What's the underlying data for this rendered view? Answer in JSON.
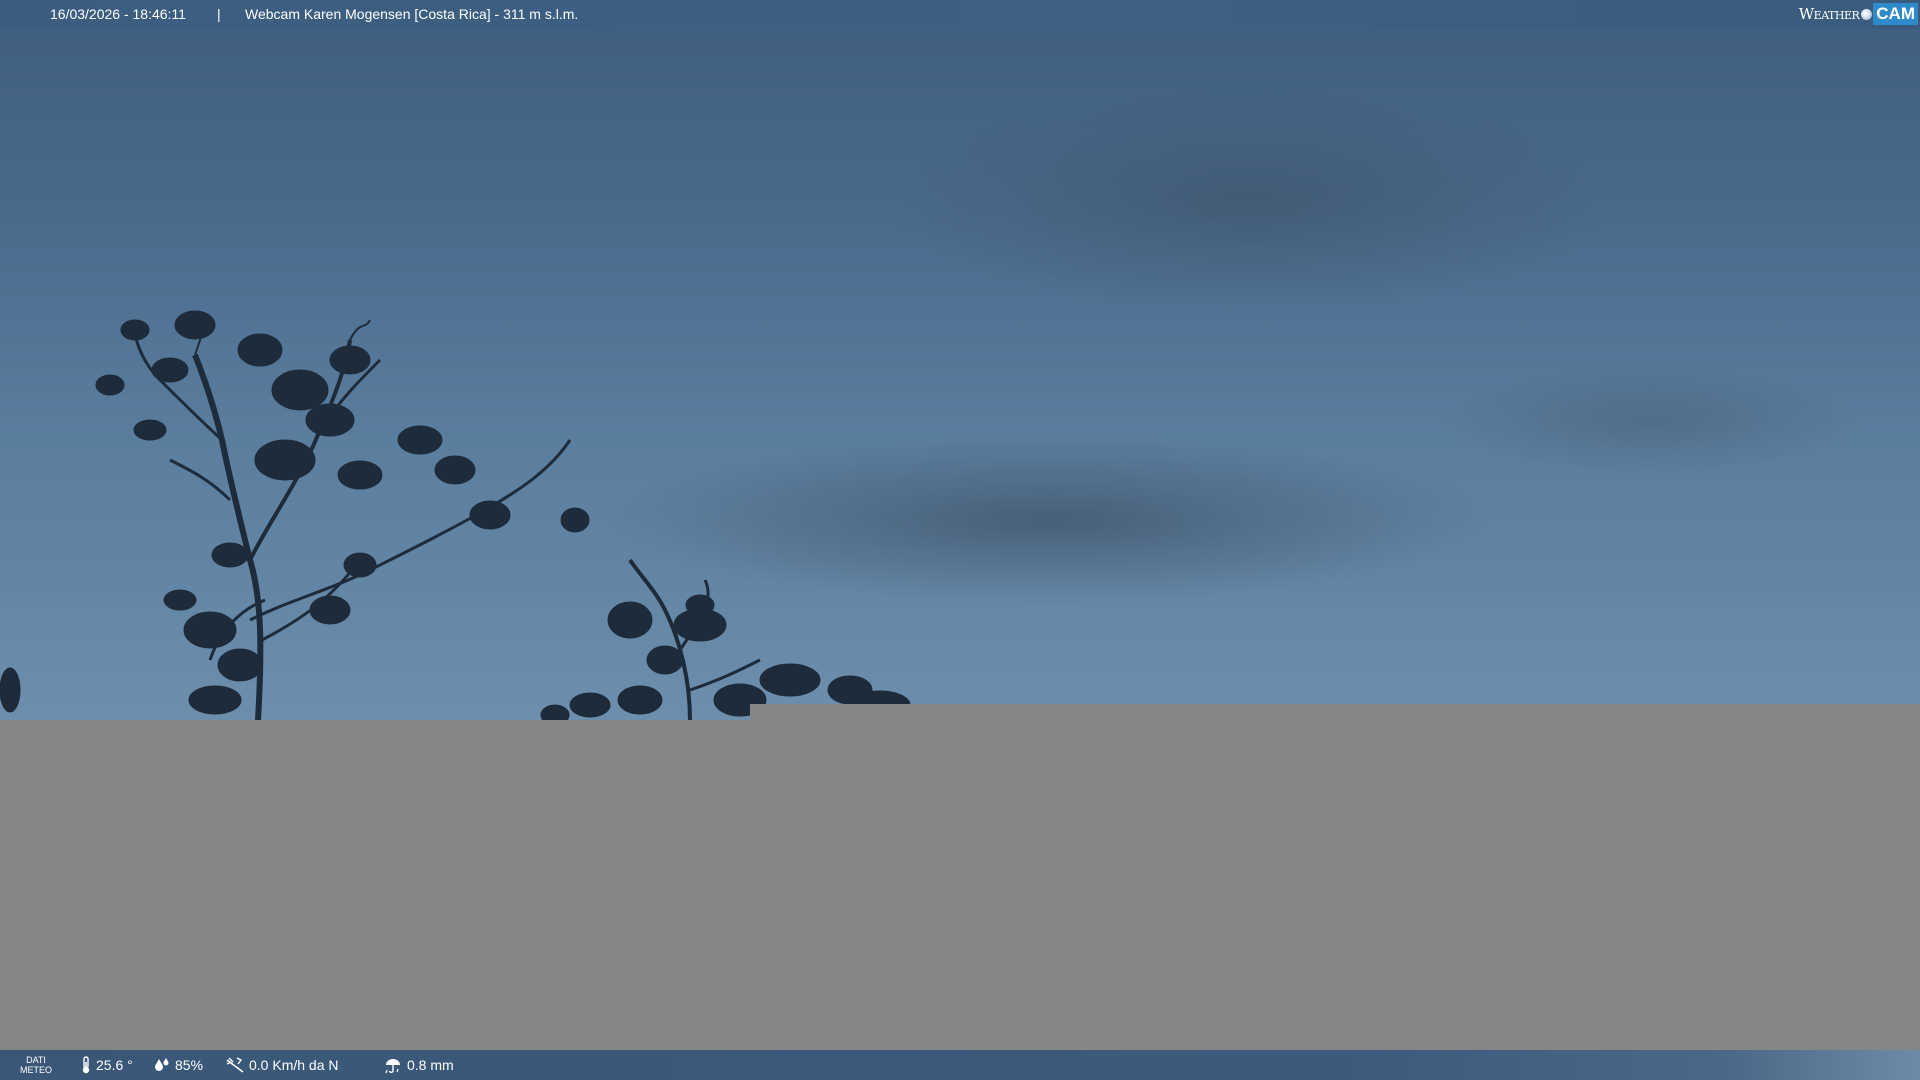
{
  "header": {
    "datetime": "16/03/2026 - 18:46:11",
    "separator": "|",
    "title": "Webcam Karen Mogensen [Costa Rica]  - 311 m s.l.m."
  },
  "logo": {
    "weather": "Weather",
    "cam": "CAM"
  },
  "footer": {
    "dati_label": "DATI",
    "meteo_label": "METEO",
    "temperature": "25.6 °",
    "humidity": "85%",
    "wind": "0.0 Km/h da N",
    "rain": "0.8 mm"
  },
  "icons": {
    "temperature": "thermometer-icon",
    "humidity": "humidity-icon",
    "wind": "wind-icon",
    "rain": "rain-icon"
  }
}
